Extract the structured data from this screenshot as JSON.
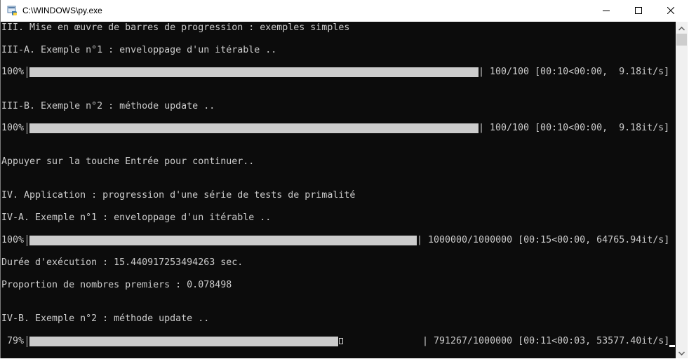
{
  "window": {
    "title": "C:\\WINDOWS\\py.exe",
    "icon": "python-console-icon",
    "controls": [
      "minimize-icon",
      "maximize-icon",
      "close-icon"
    ]
  },
  "console": {
    "lines": {
      "l0": "III. Mise en œuvre de barres de progression : exemples simples",
      "l1": "III-A. Exemple n°1 : enveloppage d'un itérable ..",
      "l2": "III-B. Exemple n°2 : méthode update ..",
      "l3": "Appuyer sur la touche Entrée pour continuer..",
      "l4": "IV. Application : progression d'une série de tests de primalité",
      "l5": "IV-A. Exemple n°1 : enveloppage d'un itérable ..",
      "l6": "Durée d'exécution : 15.440917253494263 sec.",
      "l7": "Proportion de nombres premiers : 0.078498",
      "l8": "IV-B. Exemple n°2 : méthode update .."
    },
    "progress_bars": [
      {
        "label": "100%",
        "progress": 1.0,
        "stats": "| 100/100 [00:10<00:00,  9.18it/s]"
      },
      {
        "label": "100%",
        "progress": 1.0,
        "stats": "| 100/100 [00:10<00:00,  9.18it/s]"
      },
      {
        "label": "100%",
        "progress": 1.0,
        "stats": "| 1000000/1000000 [00:15<00:00, 64765.94it/s]"
      },
      {
        "label": " 79%",
        "progress": 0.79,
        "stats": "| 791267/1000000 [00:11<00:03, 53577.40it/s]"
      }
    ]
  },
  "colors": {
    "console_bg": "#0c0c0c",
    "console_fg": "#cccccc",
    "bar_fill": "#cccccc"
  }
}
